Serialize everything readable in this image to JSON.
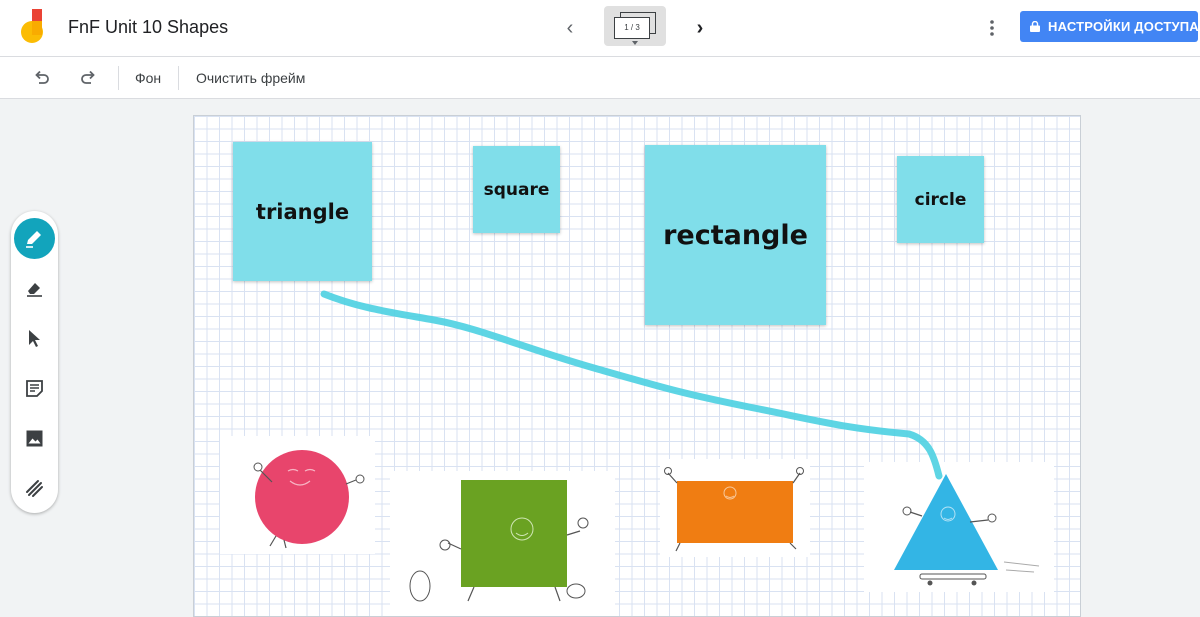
{
  "app": {
    "title": "FnF Unit 10 Shapes",
    "frame_indicator": "1 / 3",
    "share_label": "НАСТРОЙКИ ДОСТУПА",
    "accent": "#4285f4"
  },
  "toolbar": {
    "undo_icon": "undo-icon",
    "redo_icon": "redo-icon",
    "background_label": "Фон",
    "clear_frame_label": "Очистить фрейм"
  },
  "tools": [
    {
      "name": "pen-icon",
      "active": true
    },
    {
      "name": "eraser-icon",
      "active": false
    },
    {
      "name": "select-icon",
      "active": false
    },
    {
      "name": "sticky-note-icon",
      "active": false
    },
    {
      "name": "image-icon",
      "active": false
    },
    {
      "name": "laser-icon",
      "active": false
    }
  ],
  "canvas": {
    "stickies": [
      {
        "text": "triangle"
      },
      {
        "text": "square"
      },
      {
        "text": "rectangle"
      },
      {
        "text": "circle"
      }
    ],
    "sticky_color": "#80deea",
    "pen_stroke_color": "#4dd0e1",
    "images": [
      {
        "name": "circle-character-image",
        "color": "#e8456c"
      },
      {
        "name": "square-character-image",
        "color": "#6aa222"
      },
      {
        "name": "rectangle-character-image",
        "color": "#f07d12"
      },
      {
        "name": "triangle-character-image",
        "color": "#33b5e5"
      }
    ]
  }
}
